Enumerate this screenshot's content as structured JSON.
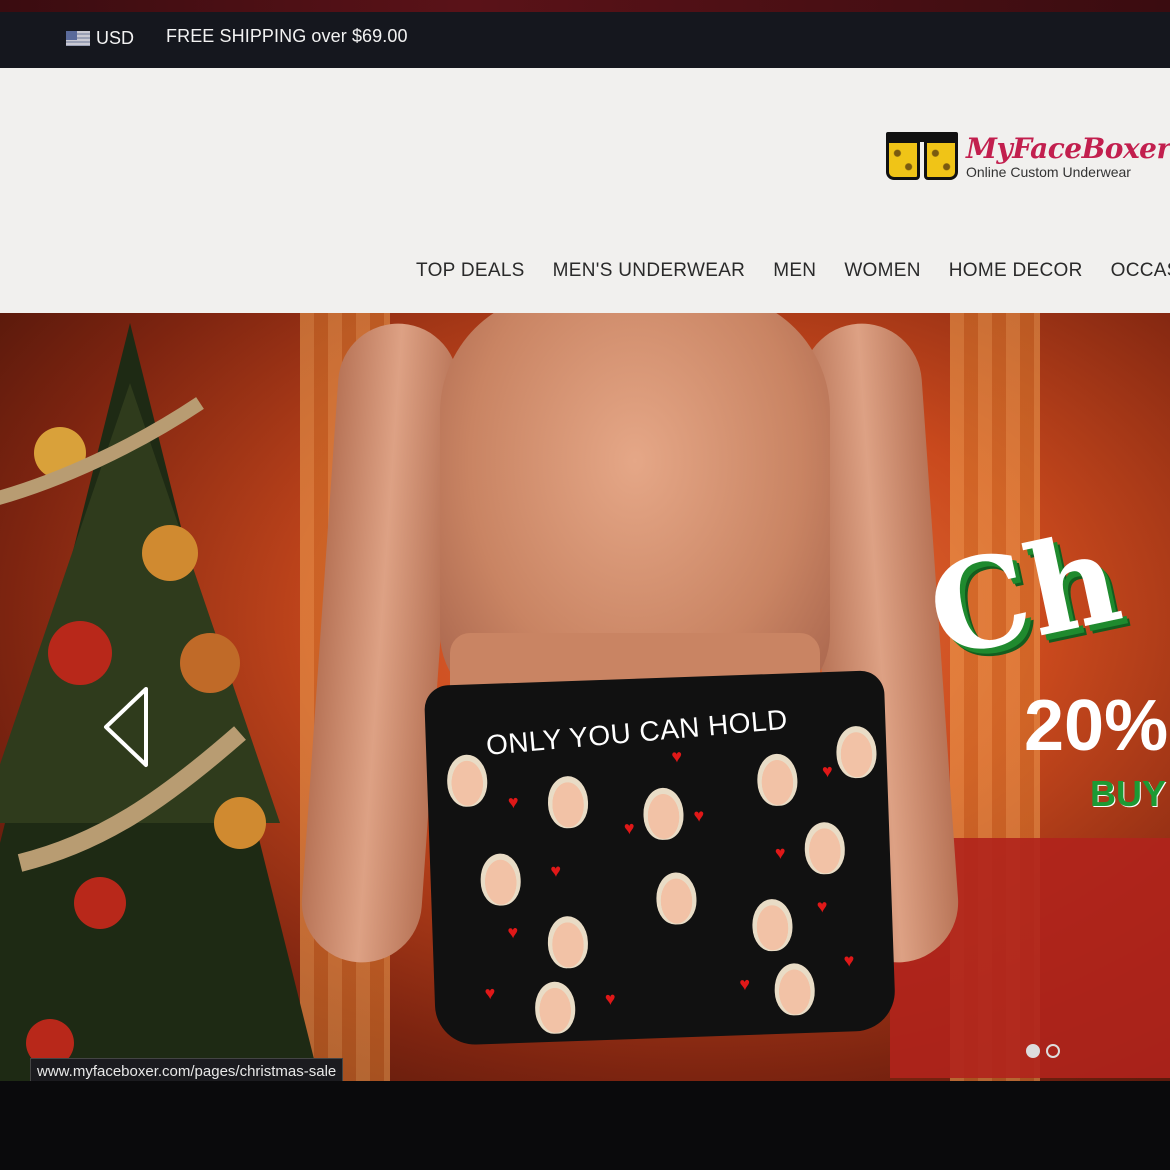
{
  "announcement": {
    "currency": "USD",
    "shipping_text": "FREE SHIPPING over $69.00"
  },
  "header": {
    "logo_name": "MyFaceBoxer",
    "logo_tagline": "Online Custom Underwear"
  },
  "nav": {
    "items": [
      {
        "label": "TOP DEALS"
      },
      {
        "label": "MEN'S UNDERWEAR"
      },
      {
        "label": "MEN"
      },
      {
        "label": "WOMEN"
      },
      {
        "label": "HOME DECOR"
      },
      {
        "label": "OCCAS"
      }
    ]
  },
  "hero": {
    "boxer_text": "ONLY YOU CAN HOLD",
    "promo_title": "Ch",
    "promo_discount": "20%",
    "promo_cta": "BUY"
  },
  "status_bar": {
    "url": "www.myfaceboxer.com/pages/christmas-sale"
  },
  "colors": {
    "brand": "#c21f4e",
    "promo_green": "#1f8a2e",
    "announce_bg": "#15171e"
  },
  "icons": [
    "flag-icon",
    "logo-boxer-icon",
    "chevron-left-icon"
  ]
}
